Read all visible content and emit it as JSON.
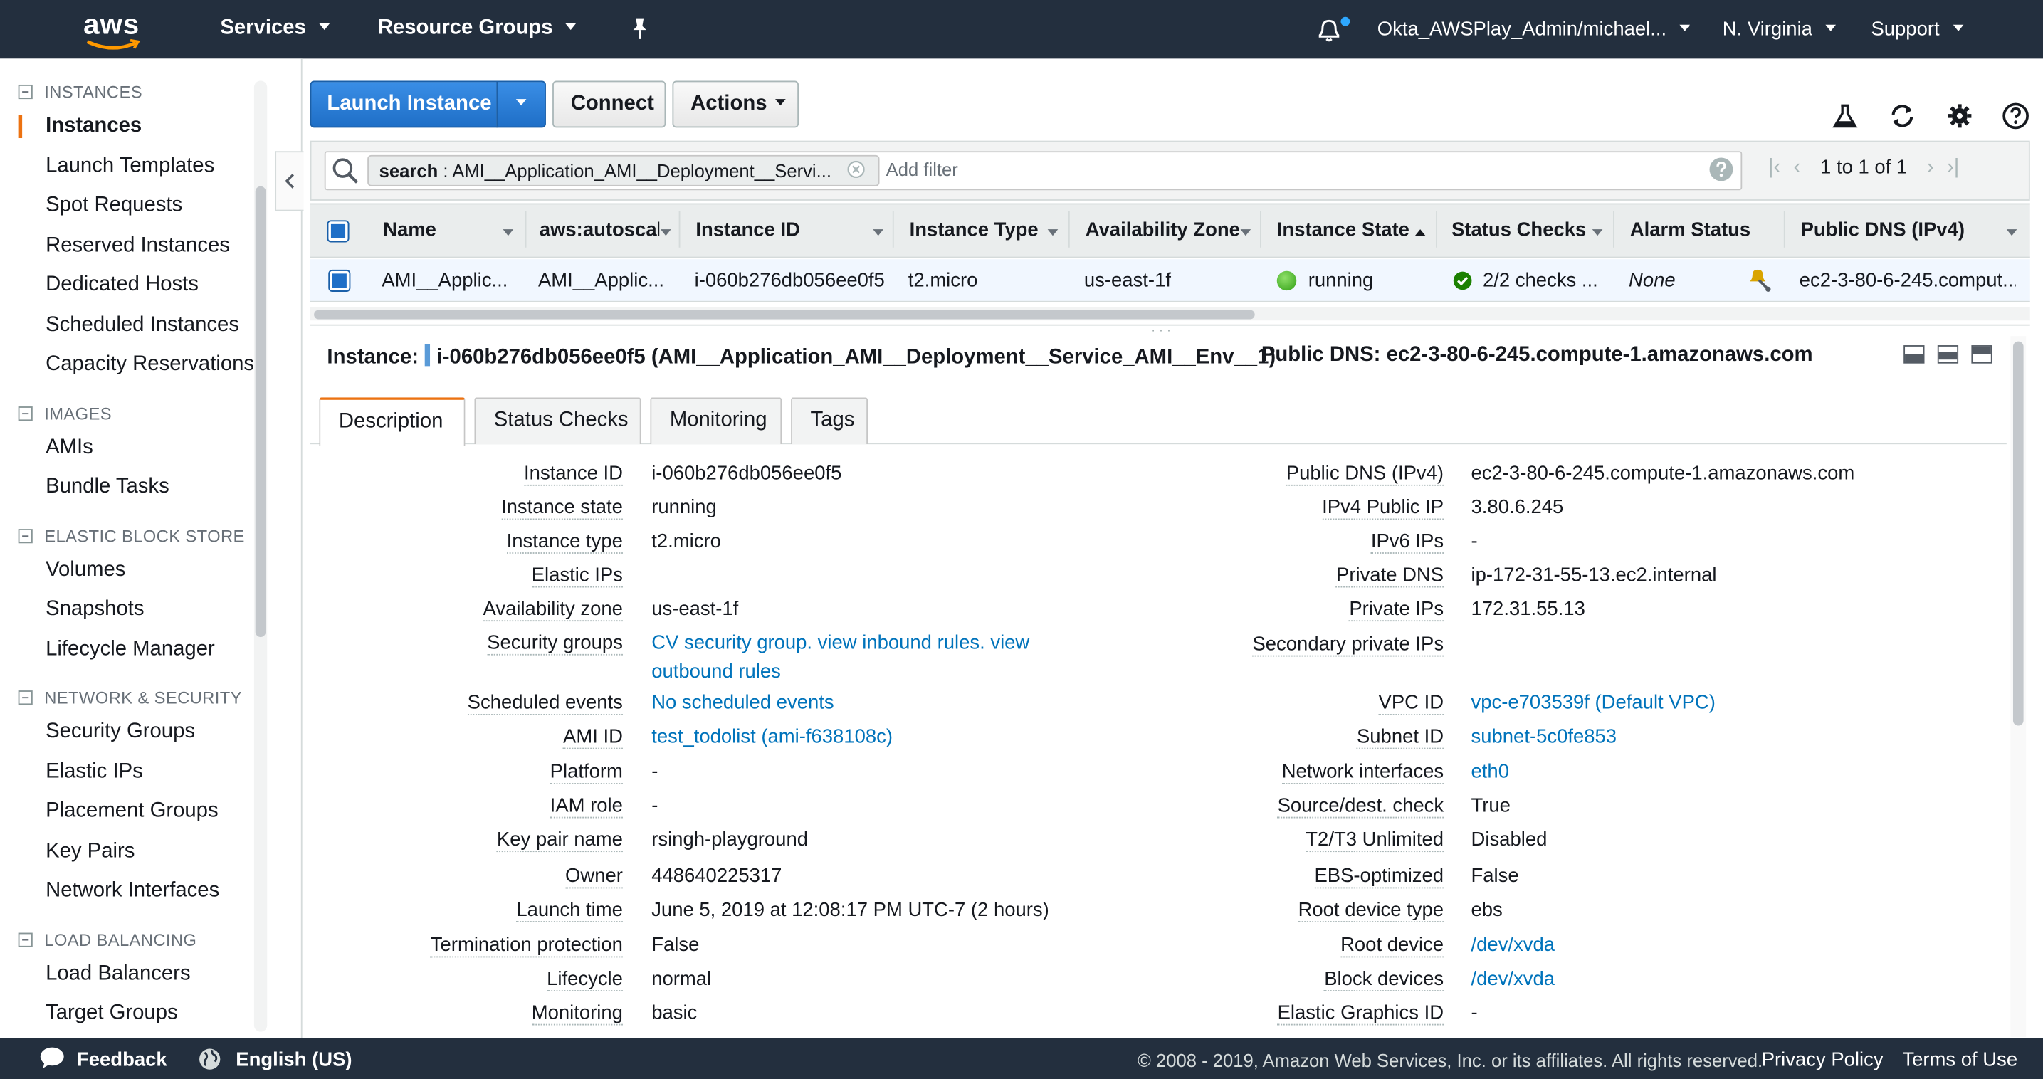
{
  "topnav": {
    "logo_text": "aws",
    "services": "Services",
    "resource_groups": "Resource Groups",
    "account": "Okta_AWSPlay_Admin/michael...",
    "region": "N. Virginia",
    "support": "Support"
  },
  "sidebar": {
    "sections": [
      {
        "title": "INSTANCES",
        "items": [
          "Instances",
          "Launch Templates",
          "Spot Requests",
          "Reserved Instances",
          "Dedicated Hosts",
          "Scheduled Instances",
          "Capacity Reservations"
        ]
      },
      {
        "title": "IMAGES",
        "items": [
          "AMIs",
          "Bundle Tasks"
        ]
      },
      {
        "title": "ELASTIC BLOCK STORE",
        "items": [
          "Volumes",
          "Snapshots",
          "Lifecycle Manager"
        ]
      },
      {
        "title": "NETWORK & SECURITY",
        "items": [
          "Security Groups",
          "Elastic IPs",
          "Placement Groups",
          "Key Pairs",
          "Network Interfaces"
        ]
      },
      {
        "title": "LOAD BALANCING",
        "items": [
          "Load Balancers",
          "Target Groups"
        ]
      }
    ],
    "active_item": "Instances"
  },
  "toolbar": {
    "launch_instance": "Launch Instance",
    "connect": "Connect",
    "actions": "Actions"
  },
  "filter": {
    "chip_key": "search",
    "chip_value": " : AMI__Application_AMI__Deployment__Servi...",
    "placeholder": "Add filter",
    "pager": "1 to 1 of 1"
  },
  "table": {
    "columns": [
      "Name",
      "aws:autoscal",
      "Instance ID",
      "Instance Type",
      "Availability Zone",
      "Instance State",
      "Status Checks",
      "Alarm Status",
      "Public DNS (IPv4)"
    ],
    "rows": [
      {
        "name": "AMI__Applic...",
        "autoscal": "AMI__Applic...",
        "instance_id": "i-060b276db056ee0f5",
        "instance_type": "t2.micro",
        "az": "us-east-1f",
        "state": "running",
        "status_checks": "2/2 checks ...",
        "alarm": "None",
        "public_dns": "ec2-3-80-6-245.comput..."
      }
    ]
  },
  "details": {
    "instance_label": "Instance:",
    "instance_title": "i-060b276db056ee0f5 (AMI__Application_AMI__Deployment__Service_AMI__Env__1)",
    "public_dns_label": "Public DNS:",
    "public_dns_value": "ec2-3-80-6-245.compute-1.amazonaws.com",
    "tabs": [
      "Description",
      "Status Checks",
      "Monitoring",
      "Tags"
    ],
    "left": [
      {
        "label": "Instance ID",
        "value": "i-060b276db056ee0f5"
      },
      {
        "label": "Instance state",
        "value": "running"
      },
      {
        "label": "Instance type",
        "value": "t2.micro"
      },
      {
        "label": "Elastic IPs",
        "value": ""
      },
      {
        "label": "Availability zone",
        "value": "us-east-1f"
      },
      {
        "label": "Security groups",
        "value": "CV security group. view inbound rules. view",
        "value2": "outbound rules"
      },
      {
        "label": "Scheduled events",
        "value": "No scheduled events"
      },
      {
        "label": "AMI ID",
        "value": "test_todolist (ami-f638108c)"
      },
      {
        "label": "Platform",
        "value": "-"
      },
      {
        "label": "IAM role",
        "value": "-"
      },
      {
        "label": "Key pair name",
        "value": "rsingh-playground"
      },
      {
        "label": "Owner",
        "value": "448640225317"
      },
      {
        "label": "Launch time",
        "value": "June 5, 2019 at 12:08:17 PM UTC-7 (2 hours)"
      },
      {
        "label": "Termination protection",
        "value": "False"
      },
      {
        "label": "Lifecycle",
        "value": "normal"
      },
      {
        "label": "Monitoring",
        "value": "basic"
      }
    ],
    "right": [
      {
        "label": "Public DNS (IPv4)",
        "value": "ec2-3-80-6-245.compute-1.amazonaws.com"
      },
      {
        "label": "IPv4 Public IP",
        "value": "3.80.6.245"
      },
      {
        "label": "IPv6 IPs",
        "value": "-"
      },
      {
        "label": "Private DNS",
        "value": "ip-172-31-55-13.ec2.internal"
      },
      {
        "label": "Private IPs",
        "value": "172.31.55.13"
      },
      {
        "label": "Secondary private IPs",
        "value": ""
      },
      {
        "label": "VPC ID",
        "value": "vpc-e703539f (Default VPC)"
      },
      {
        "label": "Subnet ID",
        "value": "subnet-5c0fe853"
      },
      {
        "label": "Network interfaces",
        "value": "eth0"
      },
      {
        "label": "Source/dest. check",
        "value": "True"
      },
      {
        "label": "T2/T3 Unlimited",
        "value": "Disabled"
      },
      {
        "label": "EBS-optimized",
        "value": "False"
      },
      {
        "label": "Root device type",
        "value": "ebs"
      },
      {
        "label": "Root device",
        "value": "/dev/xvda"
      },
      {
        "label": "Block devices",
        "value": "/dev/xvda"
      },
      {
        "label": "Elastic Graphics ID",
        "value": "-"
      }
    ]
  },
  "footer": {
    "feedback": "Feedback",
    "language": "English (US)",
    "copyright": "© 2008 - 2019, Amazon Web Services, Inc. or its affiliates. All rights reserved.",
    "privacy": "Privacy Policy",
    "terms": "Terms of Use"
  },
  "colors": {
    "nav_bg": "#232f3e",
    "accent": "#ec7211",
    "primary": "#1f6fc7",
    "link": "#0073bb",
    "running": "#1d8102"
  }
}
